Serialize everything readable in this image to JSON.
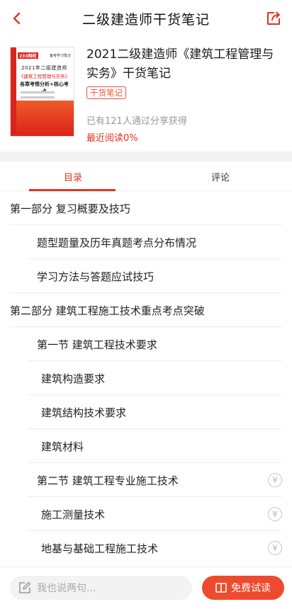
{
  "header": {
    "title": "二级建造师干货笔记"
  },
  "book": {
    "title": "2021二级建造师《建筑工程管理与实务》干货笔记",
    "badge": "干货笔记",
    "shared_text": "已有121人通过分享获得",
    "read_progress_text": "最近阅读0%",
    "cover": {
      "logo": "233网校",
      "tag": "备考学习笔记",
      "line1": "2021年二级建造师",
      "line2": "《建筑工程管理与实务》",
      "line3": "各章考情分析+核心考点"
    }
  },
  "tabs": [
    {
      "label": "目录",
      "active": true
    },
    {
      "label": "评论",
      "active": false
    }
  ],
  "toc": [
    {
      "text": "第一部分    复习概要及技巧",
      "level": 0,
      "locked": false
    },
    {
      "text": "题型题量及历年真题考点分布情况",
      "level": 1,
      "locked": false
    },
    {
      "text": "学习方法与答题应试技巧",
      "level": 1,
      "locked": false
    },
    {
      "text": "第二部分    建筑工程施工技术重点考点突破",
      "level": 0,
      "locked": false
    },
    {
      "text": "第一节  建筑工程技术要求",
      "level": 1,
      "locked": false
    },
    {
      "text": "建筑构造要求",
      "level": 2,
      "locked": false
    },
    {
      "text": "建筑结构技术要求",
      "level": 2,
      "locked": false
    },
    {
      "text": "建筑材料",
      "level": 2,
      "locked": false
    },
    {
      "text": "第二节  建筑工程专业施工技术",
      "level": 1,
      "locked": true
    },
    {
      "text": "施工测量技术",
      "level": 2,
      "locked": true
    },
    {
      "text": "地基与基础工程施工技术",
      "level": 2,
      "locked": true
    }
  ],
  "bottom": {
    "comment_placeholder": "我也说两句...",
    "try_read_label": "免费试读"
  },
  "colors": {
    "accent": "#e0341f",
    "button": "#ee4a2e"
  },
  "icons": [
    "back-arrow-icon",
    "share-icon",
    "yen-lock-icon",
    "edit-icon",
    "book-icon"
  ]
}
